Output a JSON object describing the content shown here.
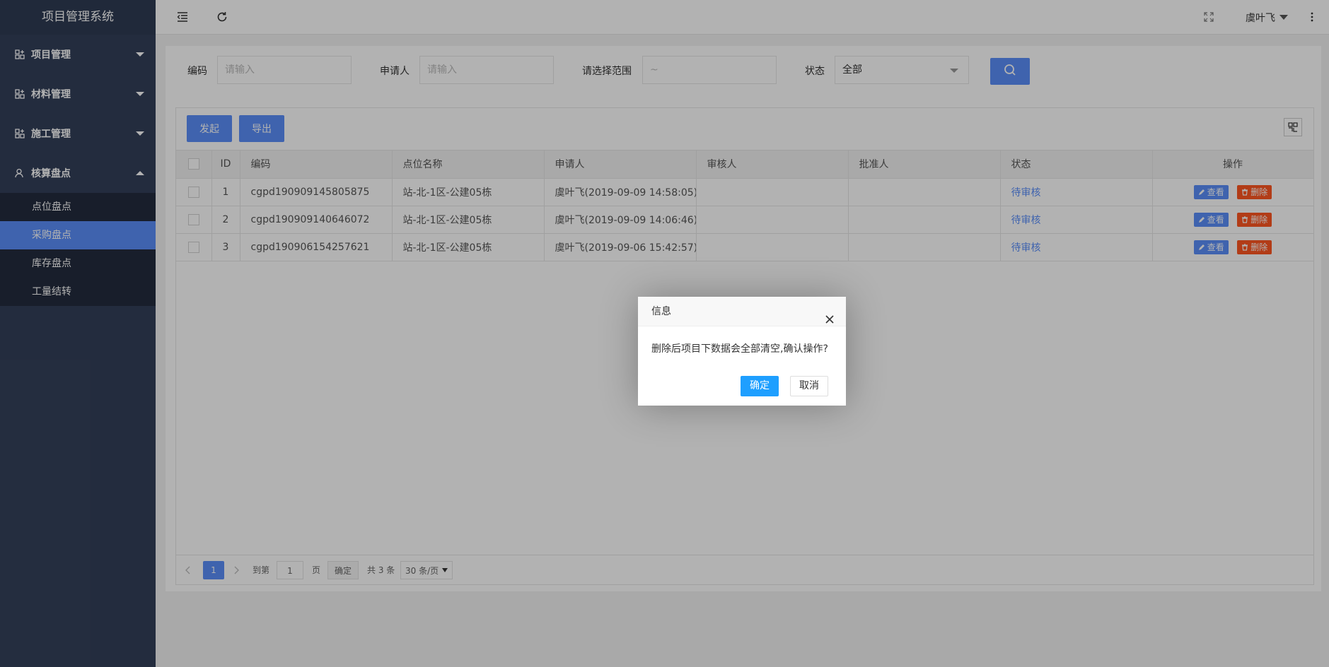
{
  "app": {
    "title": "项目管理系统"
  },
  "sidebar": {
    "menus": [
      {
        "label": "项目管理",
        "expanded": false,
        "icon": "grid-plus-icon"
      },
      {
        "label": "材料管理",
        "expanded": false,
        "icon": "grid-plus-icon"
      },
      {
        "label": "施工管理",
        "expanded": false,
        "icon": "grid-plus-icon"
      },
      {
        "label": "核算盘点",
        "expanded": true,
        "icon": "user-icon"
      }
    ],
    "submenu": [
      {
        "label": "点位盘点",
        "active": false
      },
      {
        "label": "采购盘点",
        "active": true
      },
      {
        "label": "库存盘点",
        "active": false
      },
      {
        "label": "工量结转",
        "active": false
      }
    ]
  },
  "topbar": {
    "user": "虞叶飞"
  },
  "search": {
    "code_label": "编码",
    "code_placeholder": "请输入",
    "applicant_label": "申请人",
    "applicant_placeholder": "请输入",
    "range_label": "请选择范围",
    "range_value": "~",
    "status_label": "状态",
    "status_value": "全部"
  },
  "toolbar": {
    "launch": "发起",
    "export": "导出"
  },
  "table": {
    "headers": [
      "ID",
      "编码",
      "点位名称",
      "申请人",
      "审核人",
      "批准人",
      "状态",
      "操作"
    ],
    "rows": [
      {
        "id": "1",
        "code": "cgpd190909145805875",
        "site": "站-北-1区-公建05栋",
        "applicant": "虞叶飞(2019-09-09 14:58:05)",
        "reviewer": "",
        "approver": "",
        "status": "待审核"
      },
      {
        "id": "2",
        "code": "cgpd190909140646072",
        "site": "站-北-1区-公建05栋",
        "applicant": "虞叶飞(2019-09-09 14:06:46)",
        "reviewer": "",
        "approver": "",
        "status": "待审核"
      },
      {
        "id": "3",
        "code": "cgpd190906154257621",
        "site": "站-北-1区-公建05栋",
        "applicant": "虞叶飞(2019-09-06 15:42:57)",
        "reviewer": "",
        "approver": "",
        "status": "待审核"
      }
    ],
    "view_label": "查看",
    "delete_label": "删除"
  },
  "pager": {
    "current": "1",
    "goto_label": "到第",
    "goto_value": "1",
    "page_unit": "页",
    "confirm": "确定",
    "total": "共 3 条",
    "page_size": "30 条/页"
  },
  "dialog": {
    "title": "信息",
    "message": "删除后项目下数据会全部清空,确认操作?",
    "ok": "确定",
    "cancel": "取消"
  },
  "colors": {
    "accent": "#5b8ff9",
    "danger": "#ff5722",
    "sidebar": "#33405a",
    "dialog_ok": "#1e9fff"
  }
}
